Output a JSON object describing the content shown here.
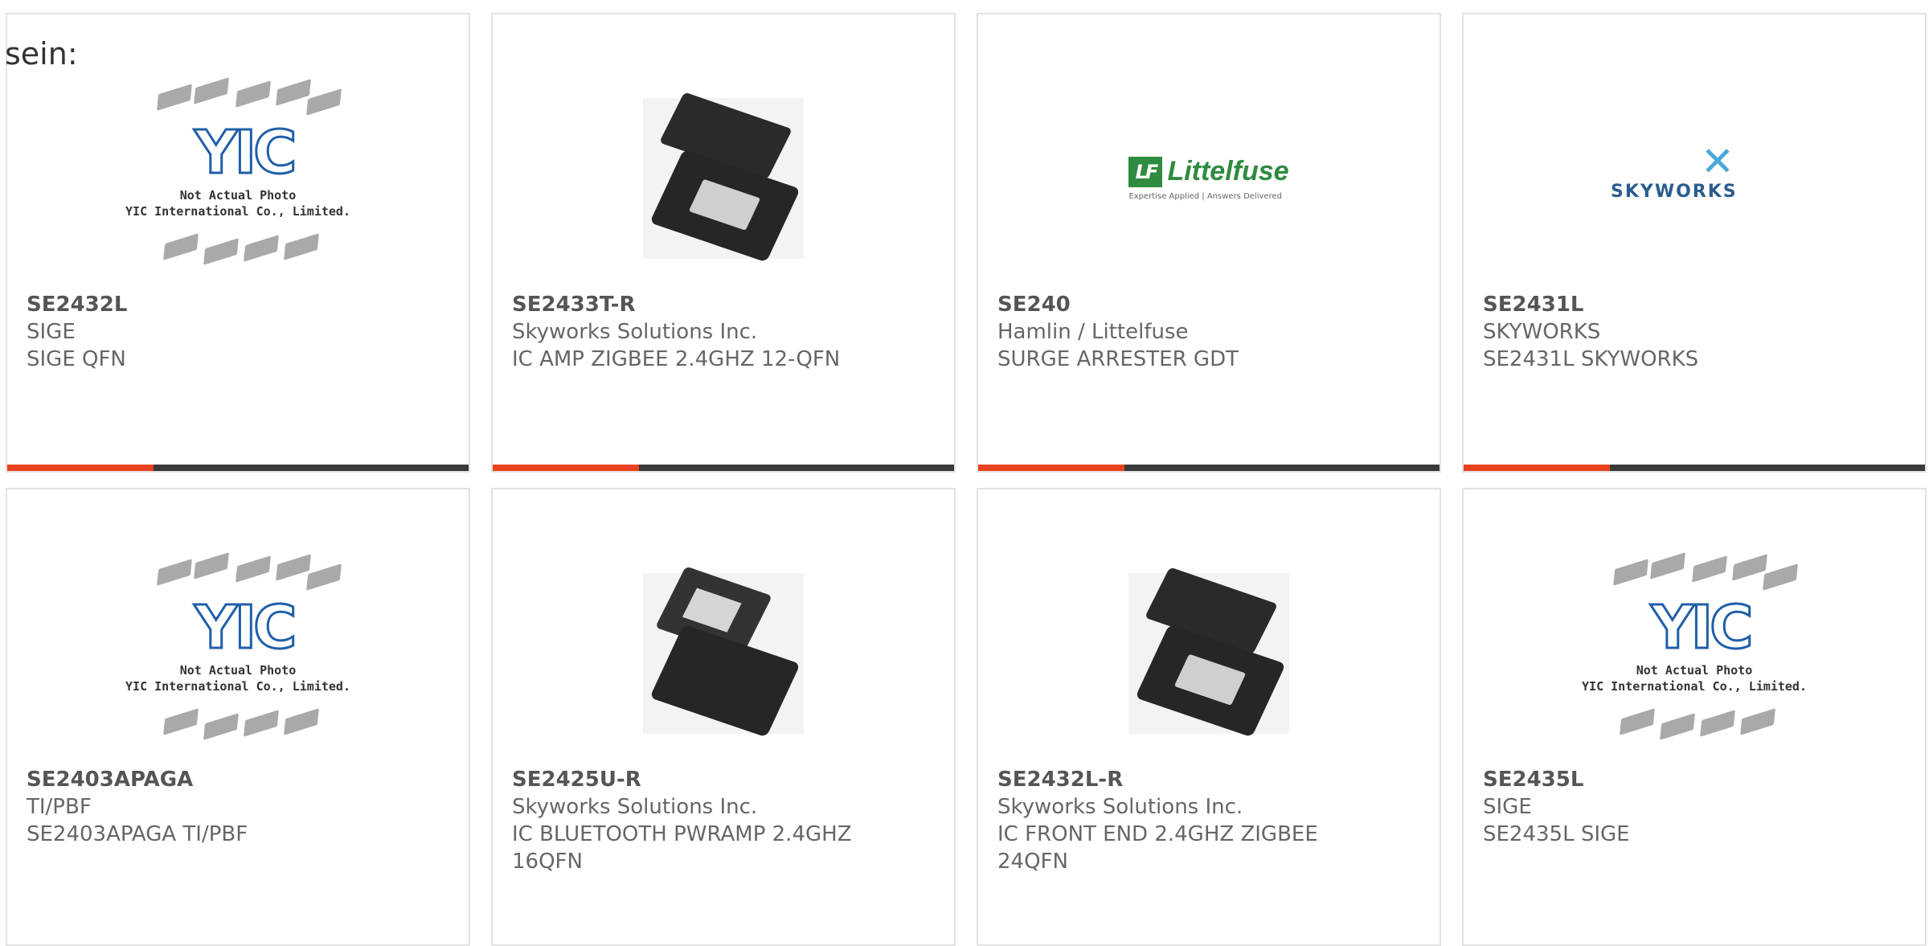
{
  "intro_text": "sein:",
  "placeholder": {
    "line1": "Not Actual Photo",
    "line2": "YIC International Co., Limited.",
    "mark": "YIC"
  },
  "logos": {
    "littelfuse": {
      "name": "Littelfuse",
      "tagline": "Expertise Applied | Answers Delivered",
      "mark": "LF",
      "color": "#2e8b3f"
    },
    "skyworks": {
      "name": "SKYWORKS",
      "color": "#2a5d8f"
    }
  },
  "colors": {
    "accent": "#e8431e",
    "bar": "#3a3a3a",
    "border": "#e2e2e2"
  },
  "products": [
    {
      "part": "SE2432L",
      "maker": "SIGE",
      "desc": "SIGE QFN",
      "image": "yic-placeholder"
    },
    {
      "part": "SE2433T-R",
      "maker": "Skyworks Solutions Inc.",
      "desc": "IC AMP ZIGBEE 2.4GHZ 12-QFN",
      "image": "qfn-chip-photo"
    },
    {
      "part": "SE240",
      "maker": "Hamlin / Littelfuse",
      "desc": "SURGE ARRESTER GDT",
      "image": "littelfuse-logo"
    },
    {
      "part": "SE2431L",
      "maker": "SKYWORKS",
      "desc": "SE2431L SKYWORKS",
      "image": "skyworks-logo"
    },
    {
      "part": "SE2403APAGA",
      "maker": "TI/PBF",
      "desc": "SE2403APAGA TI/PBF",
      "image": "yic-placeholder"
    },
    {
      "part": "SE2425U-R",
      "maker": "Skyworks Solutions Inc.",
      "desc": "IC BLUETOOTH PWRAMP 2.4GHZ",
      "desc2": "16QFN",
      "image": "qfn-chip-photo"
    },
    {
      "part": "SE2432L-R",
      "maker": "Skyworks Solutions Inc.",
      "desc": "IC FRONT END 2.4GHZ ZIGBEE",
      "desc2": "24QFN",
      "image": "qfn-chip-photo"
    },
    {
      "part": "SE2435L",
      "maker": "SIGE",
      "desc": "SE2435L SIGE",
      "image": "yic-placeholder"
    }
  ]
}
